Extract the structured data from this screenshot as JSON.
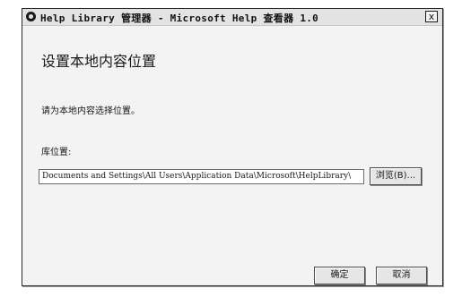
{
  "window": {
    "title": "Help Library 管理器 - Microsoft Help 查看器 1.0",
    "close_label": "x"
  },
  "dialog": {
    "heading": "设置本地内容位置",
    "instruction": "请为本地内容选择位置。",
    "location_label": "库位置:",
    "location_value": "Documents and Settings\\All Users\\Application Data\\Microsoft\\HelpLibrary\\",
    "browse_label": "浏览(B)...",
    "ok_label": "确定",
    "cancel_label": "取消"
  }
}
